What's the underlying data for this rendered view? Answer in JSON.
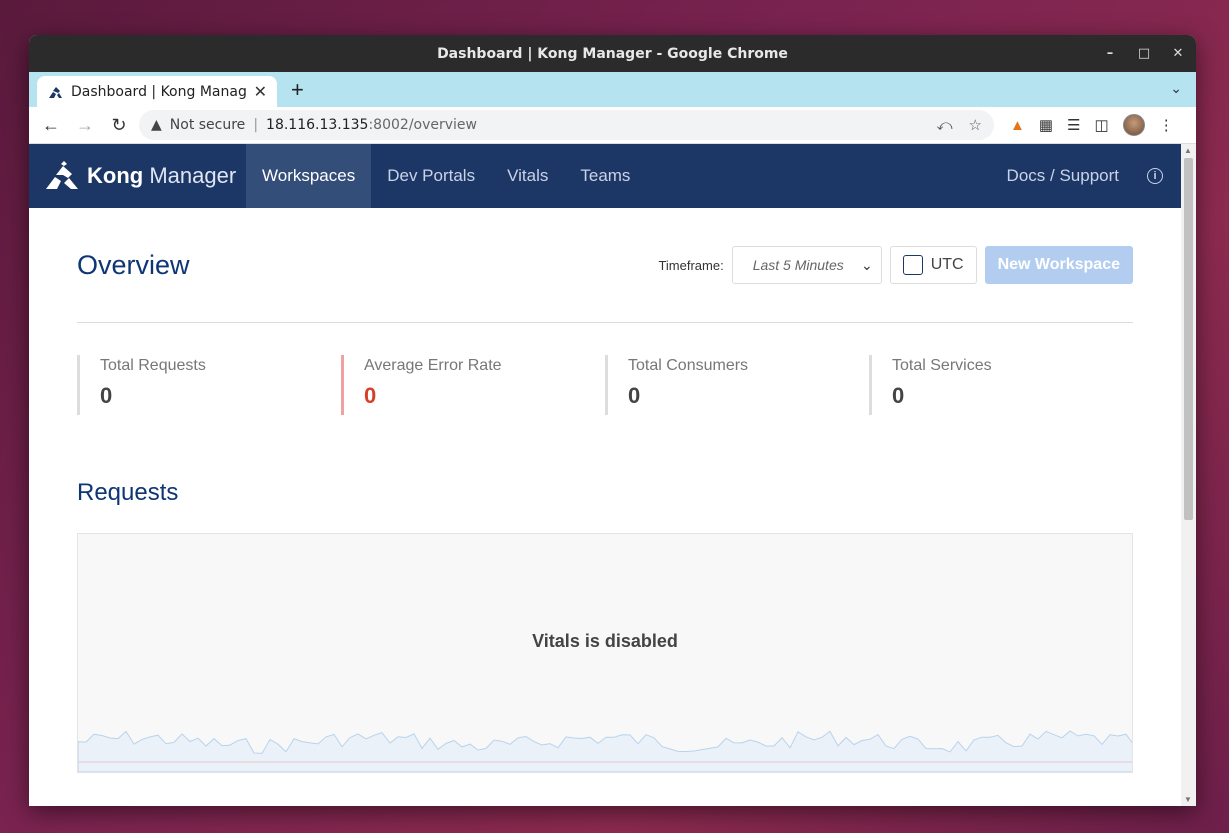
{
  "window": {
    "title": "Dashboard | Kong Manager - Google Chrome"
  },
  "tab": {
    "title": "Dashboard | Kong Manager"
  },
  "omnibox": {
    "security": "Not secure",
    "host": "18.116.13.135",
    "rest": ":8002/overview"
  },
  "app": {
    "brand_bold": "Kong",
    "brand_rest": "Manager",
    "nav": {
      "workspaces": "Workspaces",
      "dev_portals": "Dev Portals",
      "vitals": "Vitals",
      "teams": "Teams",
      "docs": "Docs / Support"
    }
  },
  "overview": {
    "title": "Overview",
    "timeframe_label": "Timeframe:",
    "timeframe_value": "Last 5 Minutes",
    "utc_label": "UTC",
    "new_workspace": "New Workspace"
  },
  "stats": [
    {
      "label": "Total Requests",
      "value": "0"
    },
    {
      "label": "Average Error Rate",
      "value": "0"
    },
    {
      "label": "Total Consumers",
      "value": "0"
    },
    {
      "label": "Total Services",
      "value": "0"
    }
  ],
  "requests": {
    "title": "Requests",
    "message": "Vitals is disabled"
  },
  "colors": {
    "nav_bg": "#1c3766",
    "accent": "#0e3574",
    "error": "#d6402a",
    "button_disabled": "#b3cdf0"
  }
}
